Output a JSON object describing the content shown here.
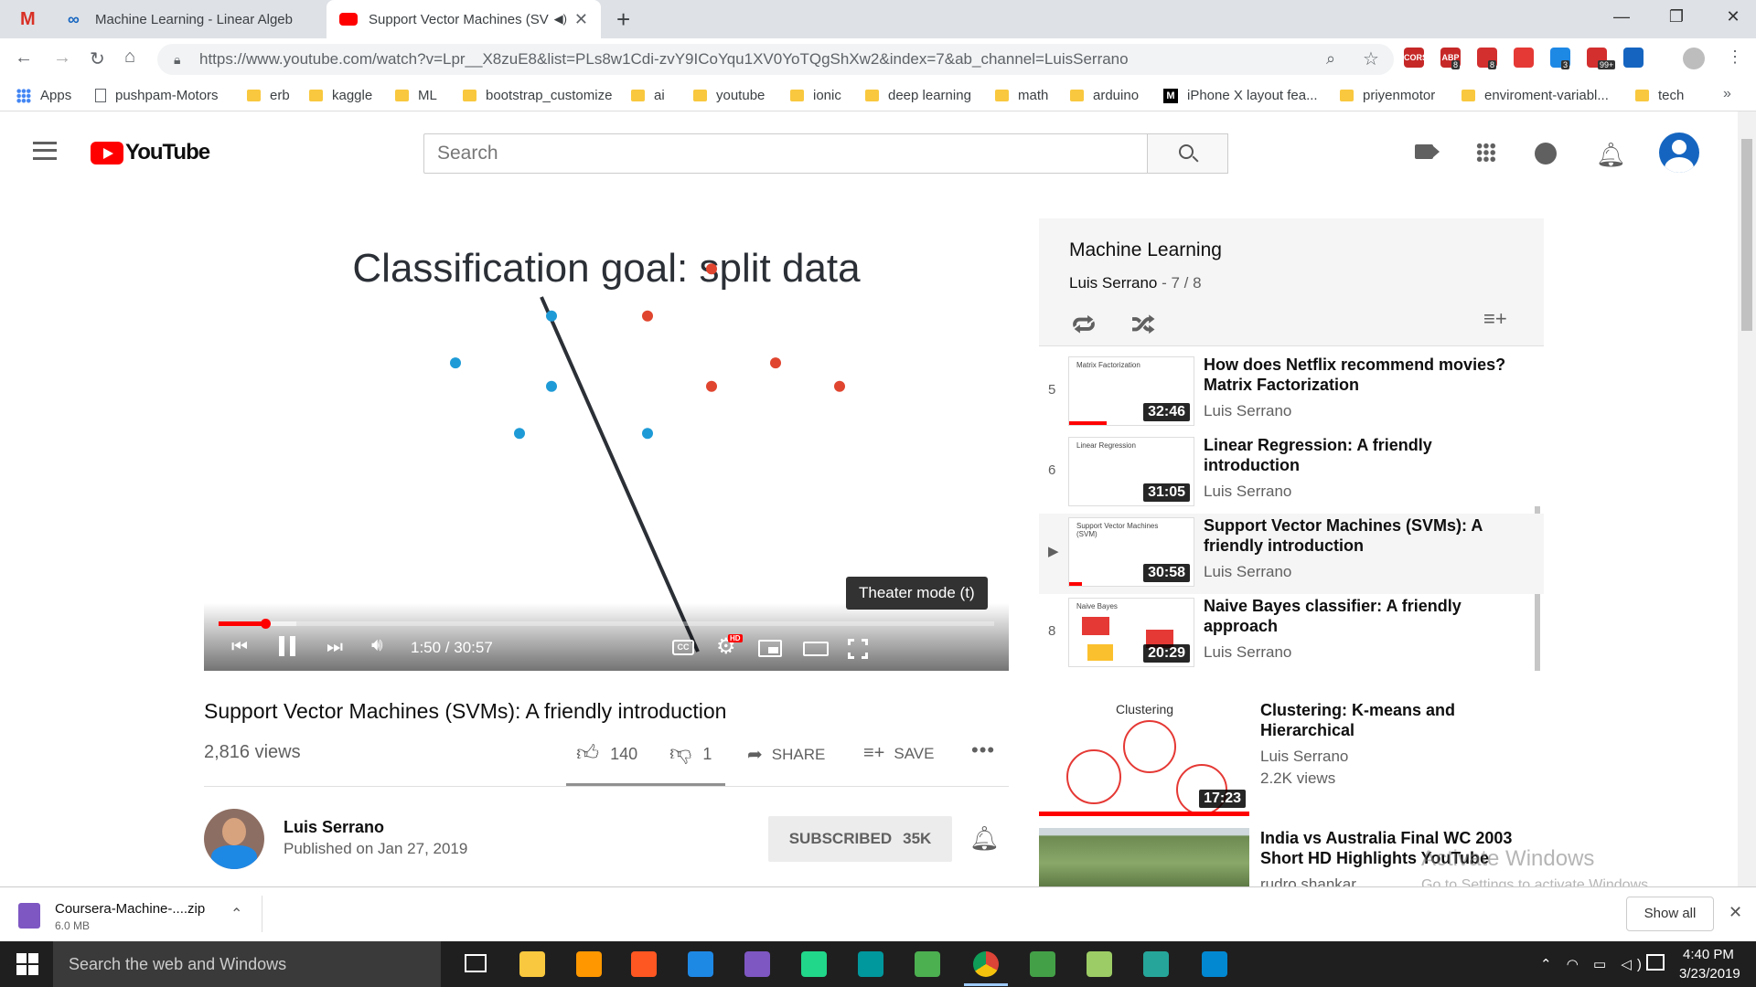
{
  "tabs": [
    {
      "title": "Machine Learning - Linear Algeb",
      "icon": "infinity-icon"
    },
    {
      "title": "Support Vector Machines (SV",
      "icon": "youtube-icon"
    }
  ],
  "url": "https://www.youtube.com/watch?v=Lpr__X8zuE8&list=PLs8w1Cdi-zvY9ICoYqu1XV0YoTQgShXw2&index=7&ab_channel=LuisSerrano",
  "extensions": [
    {
      "label": "CORS",
      "color": "#c62828"
    },
    {
      "label": "ABP",
      "color": "#c62828",
      "badge": "8"
    },
    {
      "label": "",
      "color": "#d32f2f",
      "badge": "8"
    },
    {
      "label": "",
      "color": "#e53935"
    },
    {
      "label": "",
      "color": "#1e88e5",
      "badge": "3"
    },
    {
      "label": "",
      "color": "#d32f2f",
      "badge": "99+"
    },
    {
      "label": "",
      "color": "#1565c0"
    }
  ],
  "bookmarks": [
    "Apps",
    "pushpam-Motors",
    "erb",
    "kaggle",
    "ML",
    "bootstrap_customize",
    "ai",
    "youtube",
    "ionic",
    "deep learning",
    "math",
    "arduino",
    "iPhone X layout fea...",
    "priyenmotor",
    "enviroment-variabl...",
    "tech"
  ],
  "youtube": {
    "logo": "YouTube",
    "search_placeholder": "Search"
  },
  "player": {
    "slide_title": "Classification goal: split data",
    "time": "1:50 / 30:57",
    "tooltip": "Theater mode (t)",
    "progress_fraction": 0.06,
    "buffered_fraction": 0.1
  },
  "plot": {
    "blue_points": [
      [
        6,
        7
      ],
      [
        9,
        9
      ],
      [
        9,
        6
      ],
      [
        8,
        4
      ],
      [
        12,
        4
      ]
    ],
    "red_points": [
      [
        12,
        9
      ],
      [
        14,
        11
      ],
      [
        14,
        6
      ],
      [
        16,
        7
      ],
      [
        18,
        6
      ]
    ]
  },
  "video": {
    "title": "Support Vector Machines (SVMs): A friendly introduction",
    "views": "2,816 views",
    "likes": "140",
    "dislikes": "1",
    "share": "SHARE",
    "save": "SAVE",
    "channel": "Luis Serrano",
    "published": "Published on Jan 27, 2019",
    "subscribed": "SUBSCRIBED",
    "subs": "35K"
  },
  "playlist": {
    "title": "Machine Learning",
    "owner": "Luis Serrano",
    "position": "- 7 / 8",
    "items": [
      {
        "num": "5",
        "title": "How does Netflix recommend movies? Matrix Factorization",
        "channel": "Luis Serrano",
        "duration": "32:46",
        "thumb_label": "Matrix Factorization"
      },
      {
        "num": "6",
        "title": "Linear Regression: A friendly introduction",
        "channel": "Luis Serrano",
        "duration": "31:05",
        "thumb_label": "Linear Regression"
      },
      {
        "num": "▶",
        "title": "Support Vector Machines (SVMs): A friendly introduction",
        "channel": "Luis Serrano",
        "duration": "30:58",
        "thumb_label": "Support Vector Machines (SVM)"
      },
      {
        "num": "8",
        "title": "Naive Bayes classifier: A friendly approach",
        "channel": "Luis Serrano",
        "duration": "20:29",
        "thumb_label": "Naive Bayes"
      }
    ]
  },
  "related": [
    {
      "title": "Clustering: K-means and Hierarchical",
      "channel": "Luis Serrano",
      "views": "2.2K views",
      "duration": "17:23",
      "thumb_label": "Clustering"
    },
    {
      "title": "India vs Australia Final WC 2003 Short HD Highlights YouTube",
      "channel": "rudro shankar"
    }
  ],
  "watermark": {
    "line1": "Activate Windows",
    "line2": "Go to Settings to activate Windows."
  },
  "download": {
    "file": "Coursera-Machine-....zip",
    "size": "6.0 MB",
    "show_all": "Show all"
  },
  "taskbar": {
    "search": "Search the web and Windows",
    "time": "4:40 PM",
    "date": "3/23/2019"
  }
}
